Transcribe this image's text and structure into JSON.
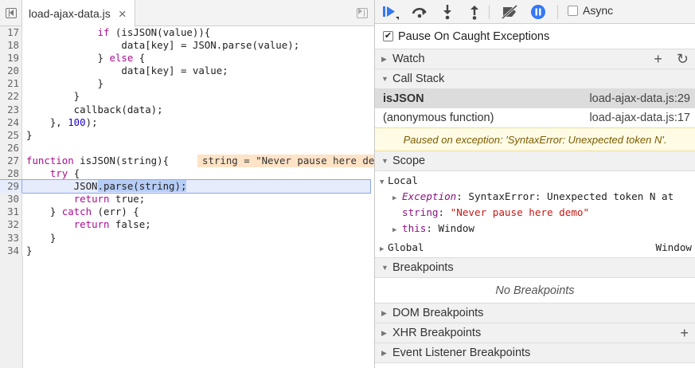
{
  "editor": {
    "tab_name": "load-ajax-data.js",
    "inline_value": "string = \"Never pause here demo\"",
    "lines": [
      {
        "n": "17",
        "html": "            <span class='kw'>if</span> (isJSON(value)){"
      },
      {
        "n": "18",
        "html": "                data[key] = JSON.parse(value);"
      },
      {
        "n": "19",
        "html": "            } <span class='kw'>else</span> {"
      },
      {
        "n": "20",
        "html": "                data[key] = value;"
      },
      {
        "n": "21",
        "html": "            }"
      },
      {
        "n": "22",
        "html": "        }"
      },
      {
        "n": "23",
        "html": "        callback(data);"
      },
      {
        "n": "24",
        "html": "    }, <span class='num'>100</span>);"
      },
      {
        "n": "25",
        "html": "}"
      },
      {
        "n": "26",
        "html": ""
      },
      {
        "n": "27",
        "html": "<span class='kw'>function</span> isJSON(string){",
        "inline": true
      },
      {
        "n": "28",
        "html": "    <span class='kw'>try</span> {"
      },
      {
        "n": "29",
        "html": "        JSON<span class='sel'>.parse(string);</span>",
        "exec": true
      },
      {
        "n": "30",
        "html": "        <span class='kw'>return</span> true;"
      },
      {
        "n": "31",
        "html": "    } <span class='kw'>catch</span> (err) {"
      },
      {
        "n": "32",
        "html": "        <span class='kw'>return</span> false;"
      },
      {
        "n": "33",
        "html": "    }"
      },
      {
        "n": "34",
        "html": "}"
      }
    ]
  },
  "toolbar": {
    "async_label": "Async"
  },
  "pause_caught_label": "Pause On Caught Exceptions",
  "sections": {
    "watch": "Watch",
    "call_stack": "Call Stack",
    "scope": "Scope",
    "breakpoints": "Breakpoints",
    "dom_breakpoints": "DOM Breakpoints",
    "xhr_breakpoints": "XHR Breakpoints",
    "event_listener_breakpoints": "Event Listener Breakpoints"
  },
  "call_stack": [
    {
      "fn": "isJSON",
      "loc": "load-ajax-data.js:29"
    },
    {
      "fn": "(anonymous function)",
      "loc": "load-ajax-data.js:17"
    }
  ],
  "exception_message": "Paused on exception: 'SyntaxError: Unexpected token N'.",
  "scope": {
    "local_label": "Local",
    "exception_name": "Exception",
    "exception_value": "SyntaxError: Unexpected token N at",
    "string_name": "string",
    "string_value": "\"Never pause here demo\"",
    "this_name": "this",
    "this_value": "Window",
    "global_label": "Global",
    "global_value": "Window"
  },
  "no_breakpoints": "No Breakpoints",
  "icons": {
    "resume": "resume-icon",
    "step_over": "step-over-icon",
    "step_into": "step-into-icon",
    "step_out": "step-out-icon",
    "deactivate": "deactivate-breakpoints-icon",
    "pause_exceptions": "pause-on-exceptions-icon"
  },
  "colors": {
    "accent_blue": "#3478f6",
    "exec_line": "#e6ecfc",
    "inline_value_bg": "#ffe3c7",
    "exception_banner": "#fffbe5"
  }
}
